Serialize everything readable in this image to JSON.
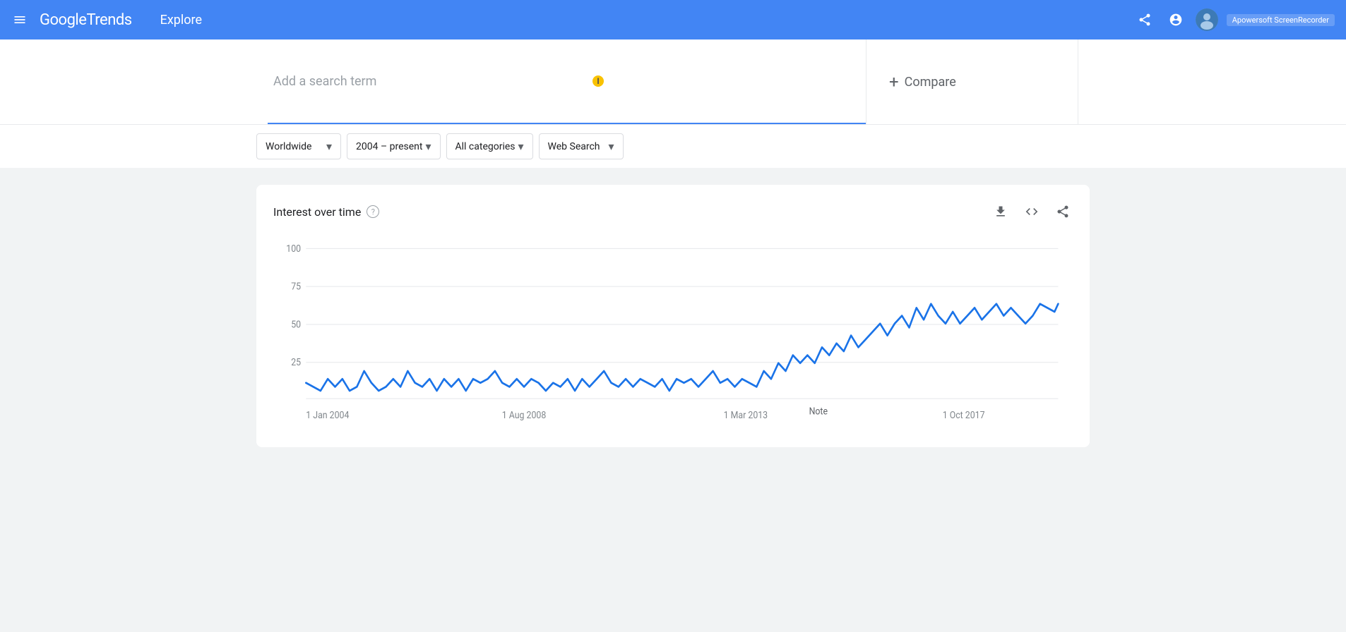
{
  "header": {
    "menu_label": "Menu",
    "logo_google": "Google",
    "logo_trends": " Trends",
    "explore_label": "Explore",
    "share_icon": "share",
    "account_icon": "account",
    "apowersoft_label": "Apowersoft ScreenRecorder"
  },
  "search": {
    "placeholder": "Add a search term",
    "compare_label": "Compare",
    "compare_icon": "+"
  },
  "filters": {
    "location": {
      "label": "Worldwide",
      "icon": "chevron-down"
    },
    "time": {
      "label": "2004 – present",
      "icon": "chevron-down"
    },
    "category": {
      "label": "All categories",
      "icon": "chevron-down"
    },
    "search_type": {
      "label": "Web Search",
      "icon": "chevron-down"
    }
  },
  "chart": {
    "title": "Interest over time",
    "help_icon": "?",
    "download_icon": "download",
    "embed_icon": "embed",
    "share_icon": "share",
    "y_axis": [
      "100",
      "75",
      "50",
      "25"
    ],
    "x_axis": [
      "1 Jan 2004",
      "1 Aug 2008",
      "1 Mar 2013",
      "1 Oct 2017"
    ],
    "note_label": "Note",
    "line_color": "#1a73e8",
    "grid_color": "#e8eaed"
  }
}
